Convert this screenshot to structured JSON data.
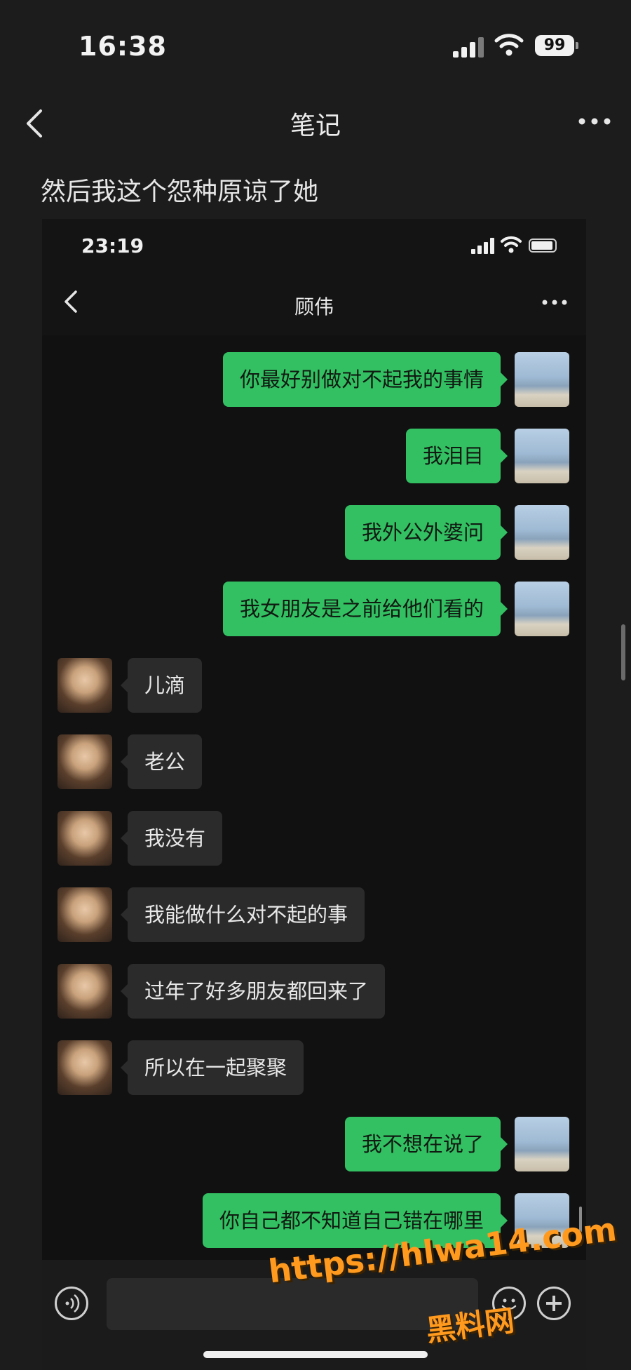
{
  "status_bar": {
    "time": "16:38",
    "battery": "99"
  },
  "nav": {
    "title": "笔记"
  },
  "note": {
    "text": "然后我这个怨种原谅了她"
  },
  "chat_screenshot": {
    "status_bar": {
      "time": "23:19"
    },
    "contact_name": "顾伟",
    "messages": [
      {
        "from": "me",
        "text": "你最好别做对不起我的事情"
      },
      {
        "from": "me",
        "text": "我泪目"
      },
      {
        "from": "me",
        "text": "我外公外婆问"
      },
      {
        "from": "me",
        "text": "我女朋友是之前给他们看的"
      },
      {
        "from": "her",
        "text": "儿滴"
      },
      {
        "from": "her",
        "text": "老公"
      },
      {
        "from": "her",
        "text": "我没有"
      },
      {
        "from": "her",
        "text": "我能做什么对不起的事"
      },
      {
        "from": "her",
        "text": "过年了好多朋友都回来了"
      },
      {
        "from": "her",
        "text": "所以在一起聚聚"
      },
      {
        "from": "me",
        "text": "我不想在说了"
      },
      {
        "from": "me",
        "text": "你自己都不知道自己错在哪里"
      }
    ]
  },
  "watermark": {
    "url": "https://hlwa14.com",
    "label": "黑料网"
  },
  "colors": {
    "sent_bubble": "#33c062",
    "received_bubble": "#2b2b2b",
    "background": "#1c1c1c",
    "watermark": "#ff9a1f"
  }
}
